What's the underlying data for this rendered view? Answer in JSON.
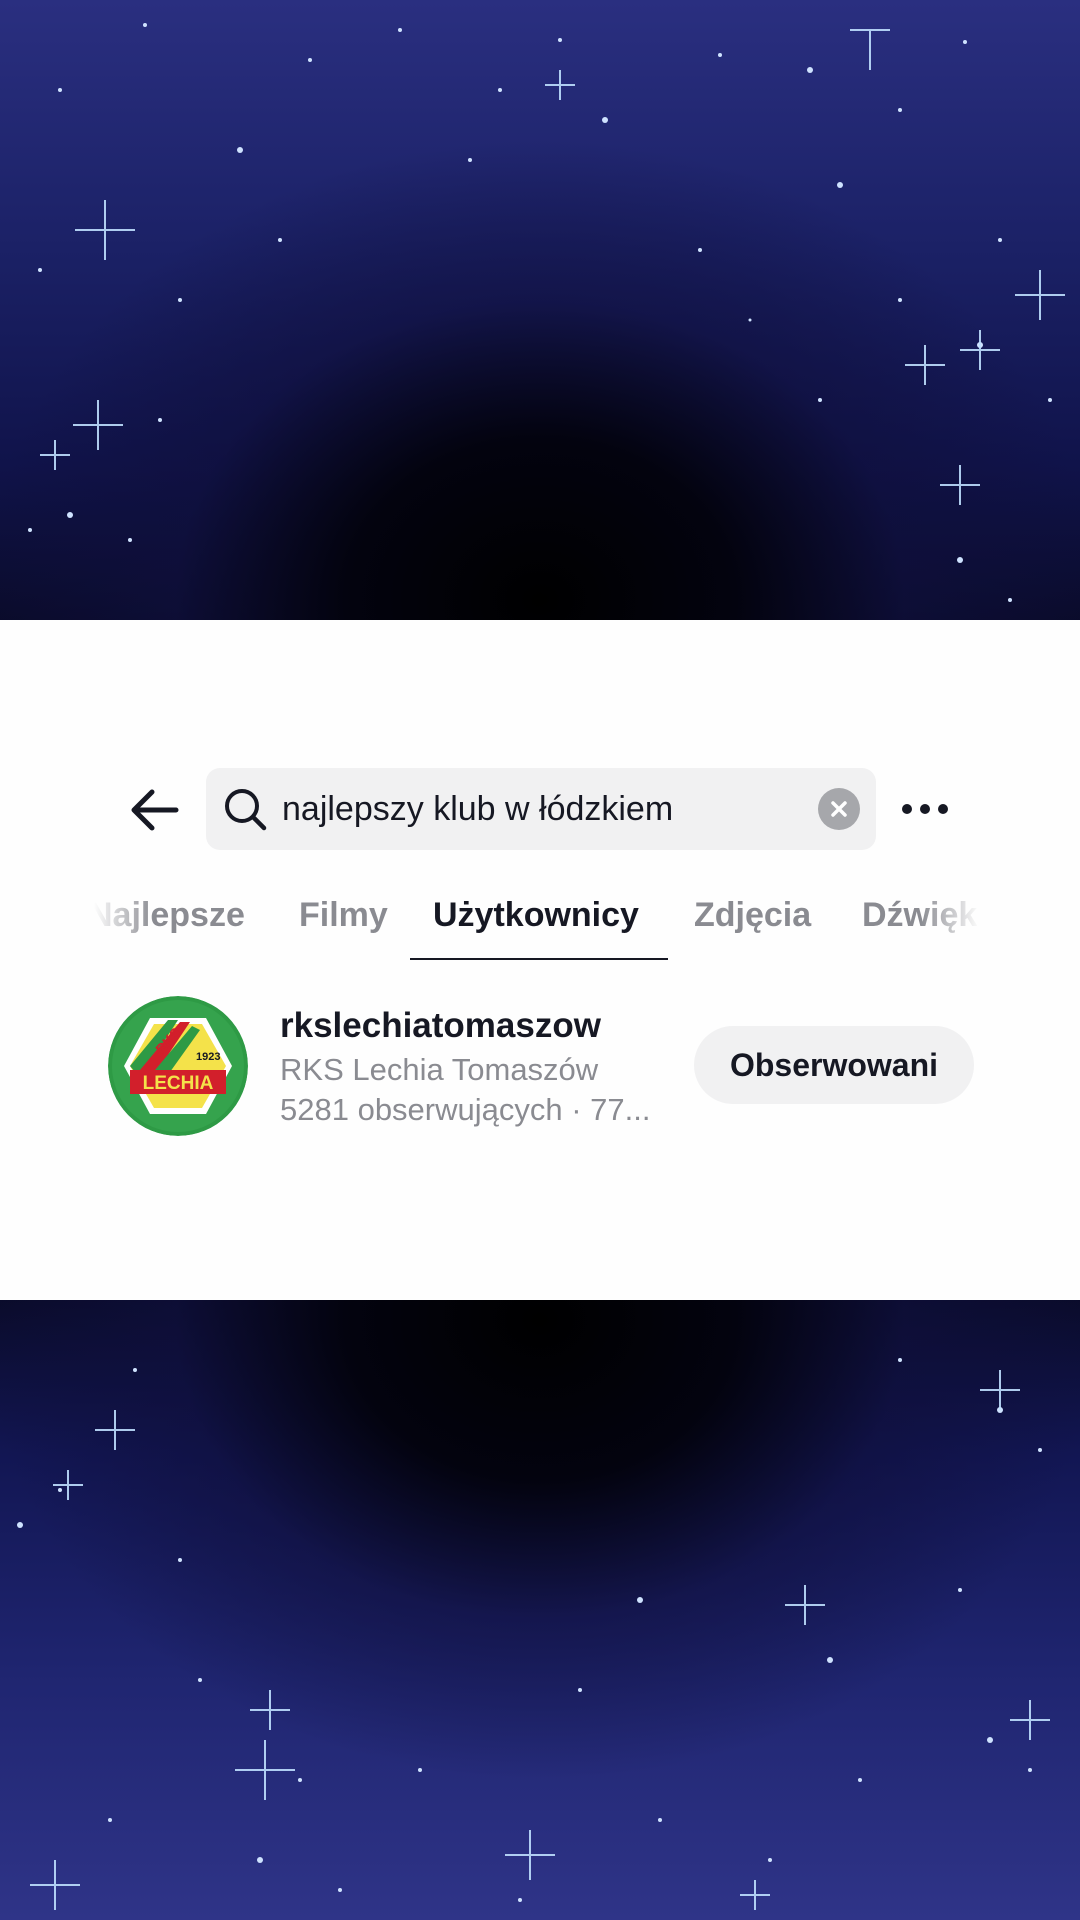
{
  "search": {
    "query": "najlepszy klub w łódzkiem"
  },
  "tabs": [
    {
      "label": "Najlepsze"
    },
    {
      "label": "Filmy"
    },
    {
      "label": "Użytkownicy"
    },
    {
      "label": "Zdjęcia"
    },
    {
      "label": "Dźwięki"
    }
  ],
  "active_tab": "Użytkownicy",
  "result": {
    "username": "rkslechiatomaszow",
    "display_name": "RKS Lechia Tomaszów",
    "stats": "5281 obserwujących · 77...",
    "follow_label": "Obserwowani",
    "avatar_logo": {
      "text_top": "RKS",
      "year": "1923",
      "text_main": "LECHIA"
    }
  },
  "colors": {
    "text_primary": "#161823",
    "text_secondary": "#8a8b91",
    "chip_bg": "#f1f1f2",
    "logo_green": "#2e9a45",
    "logo_red": "#d21f2b",
    "logo_yellow": "#f4e24a"
  },
  "icons": {
    "back": "arrow-left-icon",
    "search": "search-icon",
    "clear": "clear-x-icon",
    "more": "more-dots-icon"
  }
}
